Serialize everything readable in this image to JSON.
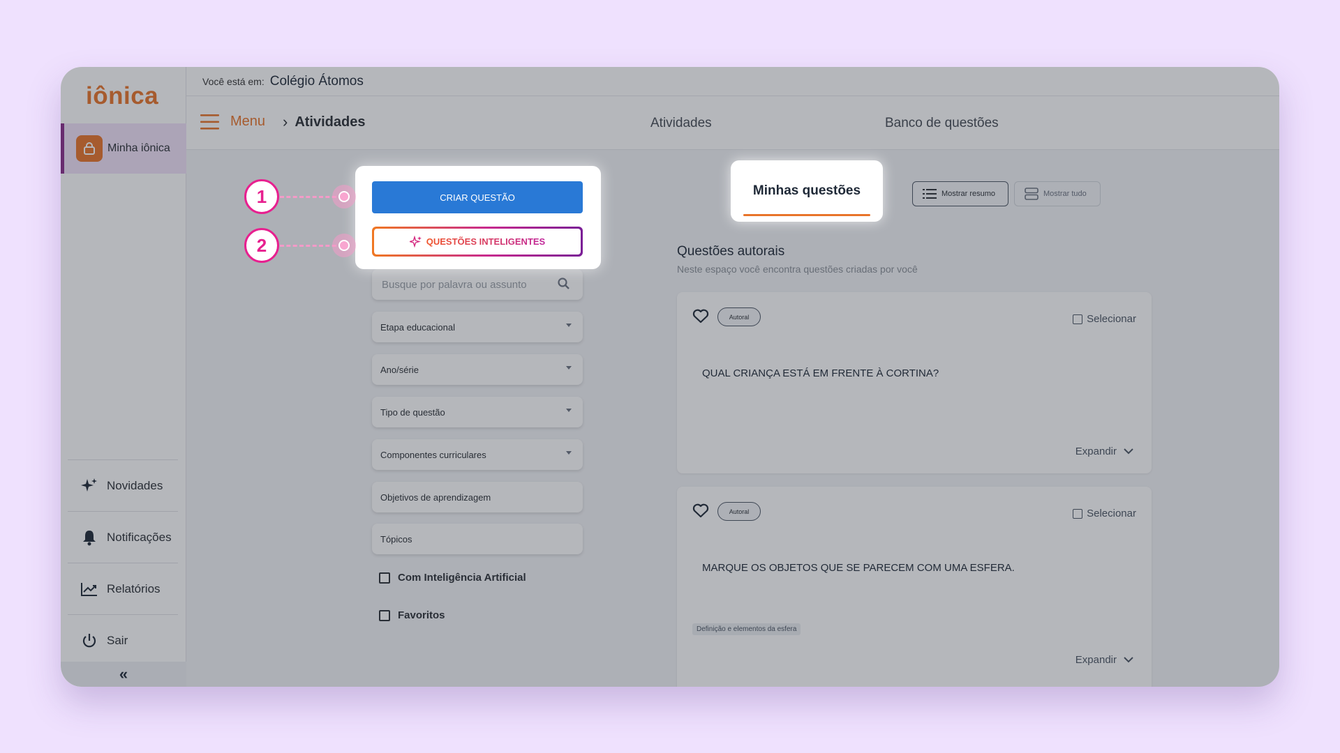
{
  "app": {
    "logo": "iônica"
  },
  "sidebar": {
    "active_item": "Minha iônica",
    "items": [
      {
        "label": "Novidades",
        "icon": "sparkles-icon"
      },
      {
        "label": "Notificações",
        "icon": "bell-icon"
      },
      {
        "label": "Relatórios",
        "icon": "chart-icon"
      },
      {
        "label": "Sair",
        "icon": "power-icon"
      }
    ],
    "collapse": "«"
  },
  "header": {
    "location_label": "Você está em:",
    "school": "Colégio Átomos",
    "menu_label": "Menu",
    "breadcrumb": "Atividades"
  },
  "tabs": [
    {
      "label": "Atividades"
    },
    {
      "label": "Minhas questões",
      "active": true
    },
    {
      "label": "Banco de questões"
    }
  ],
  "actions": {
    "create": "CRIAR QUESTÃO",
    "smart": "QUESTÕES INTELIGENTES"
  },
  "steps": [
    "1",
    "2"
  ],
  "filters": {
    "search_placeholder": "Busque por palavra ou assunto",
    "selects": [
      "Etapa educacional",
      "Ano/série",
      "Tipo de questão",
      "Componentes curriculares",
      "Objetivos de aprendizagem",
      "Tópicos"
    ],
    "checkboxes": [
      "Com Inteligência Artificial",
      "Favoritos"
    ]
  },
  "view": {
    "summary": "Mostrar resumo",
    "all": "Mostrar tudo"
  },
  "section": {
    "title": "Questões autorais",
    "subtitle": "Neste espaço você encontra questões criadas por você"
  },
  "questions": [
    {
      "tag": "Autoral",
      "select": "Selecionar",
      "text": "QUAL CRIANÇA ESTÁ EM FRENTE À CORTINA?",
      "expand": "Expandir"
    },
    {
      "tag": "Autoral",
      "select": "Selecionar",
      "text": "MARQUE OS OBJETOS QUE SE PARECEM COM UMA ESFERA.",
      "topic": "Definição e elementos da esfera",
      "expand": "Expandir"
    }
  ],
  "colors": {
    "accent": "#e8742a",
    "brand": "#8b2c8c",
    "primary": "#2979d6",
    "callout": "#e7208f"
  }
}
